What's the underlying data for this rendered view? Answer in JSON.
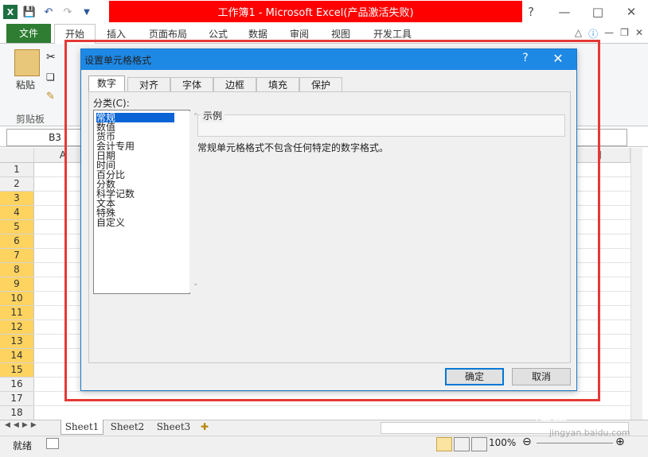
{
  "window": {
    "title": "工作簿1 - Microsoft Excel(产品激活失败)",
    "title_bar_color": "#ff0000"
  },
  "quick_access": {
    "icons": [
      "excel-icon",
      "save-icon",
      "undo-icon",
      "redo-icon",
      "customize-icon"
    ]
  },
  "ribbon": {
    "tabs": [
      "文件",
      "开始",
      "插入",
      "页面布局",
      "公式",
      "数据",
      "审阅",
      "视图",
      "开发工具"
    ],
    "active_tab": "开始",
    "clipboard": {
      "paste_label": "粘贴",
      "group_label": "剪贴板"
    }
  },
  "formula_bar": {
    "name_box": "B3"
  },
  "grid": {
    "columns": [
      "A",
      "J"
    ],
    "rows": [
      "1",
      "2",
      "3",
      "4",
      "5",
      "6",
      "7",
      "8",
      "9",
      "10",
      "11",
      "12",
      "13",
      "14",
      "15",
      "16",
      "17",
      "18"
    ]
  },
  "sheets": [
    "Sheet1",
    "Sheet2",
    "Sheet3"
  ],
  "status": {
    "ready": "就绪",
    "zoom": "100%"
  },
  "dialog": {
    "title": "设置单元格格式",
    "help": "?",
    "tabs": [
      "数字",
      "对齐",
      "字体",
      "边框",
      "填充",
      "保护"
    ],
    "active_tab": "数字",
    "category_label": "分类(C):",
    "categories": [
      "常规",
      "数值",
      "货币",
      "会计专用",
      "日期",
      "时间",
      "百分比",
      "分数",
      "科学记数",
      "文本",
      "特殊",
      "自定义"
    ],
    "selected_category": "常规",
    "example_label": "示例",
    "description": "常规单元格格式不包含任何特定的数字格式。",
    "ok_label": "确定",
    "cancel_label": "取消"
  },
  "colors": {
    "accent": "#1e88e5",
    "file_tab": "#2e7d32",
    "highlight": "#e53935",
    "row_selected": "#ffd35f"
  },
  "watermark": {
    "text": "Bai 经验",
    "url": "jingyan.baidu.com"
  }
}
